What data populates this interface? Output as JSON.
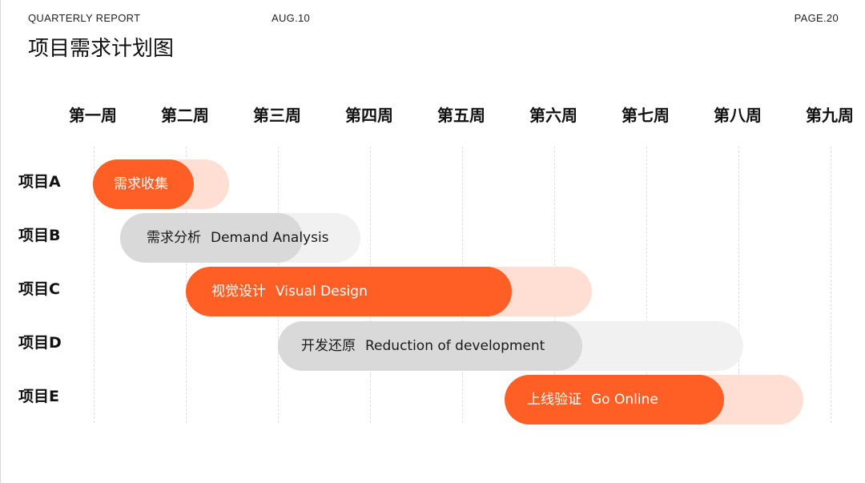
{
  "header": {
    "report_label": "QUARTERLY REPORT",
    "date": "AUG.10",
    "page": "PAGE.20"
  },
  "title": "项目需求计划图",
  "weeks": [
    "第一周",
    "第二周",
    "第三周",
    "第四周",
    "第五周",
    "第六周",
    "第七周",
    "第八周",
    "第九周"
  ],
  "projects": [
    {
      "label": "项目A",
      "task_cn": "需求收集",
      "task_en": "",
      "color": "#ff5f25"
    },
    {
      "label": "项目B",
      "task_cn": "需求分析",
      "task_en": "Demand Analysis",
      "color": "#d9d9d9"
    },
    {
      "label": "项目C",
      "task_cn": "视觉设计",
      "task_en": "Visual Design",
      "color": "#ff5f25"
    },
    {
      "label": "项目D",
      "task_cn": "开发还原",
      "task_en": "Reduction of development",
      "color": "#d9d9d9"
    },
    {
      "label": "项目E",
      "task_cn": "上线验证",
      "task_en": "Go Online",
      "color": "#ff5f25"
    }
  ],
  "colors": {
    "accent": "#ff5f25",
    "accent_light": "#ffdfd4",
    "neutral": "#d9d9d9",
    "neutral_light": "#f1f1f1"
  }
}
